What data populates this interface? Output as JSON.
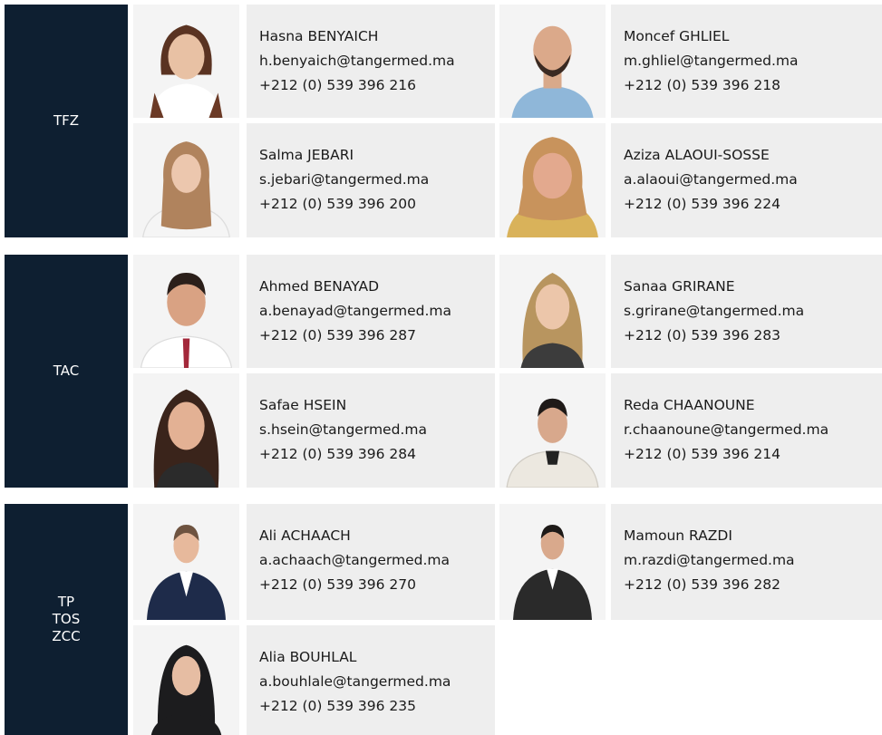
{
  "colors": {
    "zone_bg": "#0e1f31",
    "card_bg": "#eeeeee",
    "text": "#1a1a1a"
  },
  "groups": [
    {
      "zone": [
        "TFZ"
      ],
      "people": [
        {
          "name": "Hasna BENYAICH",
          "email": "h.benyaich@tangermed.ma",
          "phone": "+212 (0) 539 396 216"
        },
        {
          "name": "Moncef GHLIEL",
          "email": "m.ghliel@tangermed.ma",
          "phone": "+212 (0) 539 396 218"
        },
        {
          "name": "Salma JEBARI",
          "email": "s.jebari@tangermed.ma",
          "phone": "+212 (0) 539 396 200"
        },
        {
          "name": "Aziza ALAOUI-SOSSE",
          "email": "a.alaoui@tangermed.ma",
          "phone": "+212 (0) 539 396 224"
        }
      ]
    },
    {
      "zone": [
        "TAC"
      ],
      "people": [
        {
          "name": "Ahmed BENAYAD",
          "email": "a.benayad@tangermed.ma",
          "phone": "+212 (0) 539 396 287"
        },
        {
          "name": "Sanaa GRIRANE",
          "email": "s.grirane@tangermed.ma",
          "phone": "+212 (0) 539 396 283"
        },
        {
          "name": "Safae HSEIN",
          "email": "s.hsein@tangermed.ma",
          "phone": "+212 (0) 539 396 284"
        },
        {
          "name": "Reda CHAANOUNE",
          "email": "r.chaanoune@tangermed.ma",
          "phone": "+212 (0) 539 396 214"
        }
      ]
    },
    {
      "zone": [
        "TP",
        "TOS",
        "ZCC"
      ],
      "people": [
        {
          "name": "Ali ACHAACH",
          "email": "a.achaach@tangermed.ma",
          "phone": "+212 (0) 539 396 270"
        },
        {
          "name": "Mamoun RAZDI",
          "email": "m.razdi@tangermed.ma",
          "phone": "+212 (0) 539 396 282"
        },
        {
          "name": "Alia BOUHLAL",
          "email": "a.bouhlale@tangermed.ma",
          "phone": "+212 (0) 539 396 235"
        }
      ]
    }
  ]
}
